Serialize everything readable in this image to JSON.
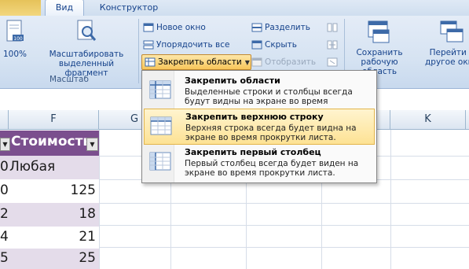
{
  "tabs": {
    "view": "Вид",
    "design": "Конструктор"
  },
  "ribbon": {
    "zoom100_label": "100%",
    "zoom_selection_label": "Масштабировать выделенный фрагмент",
    "zoom_group_label": "Масштаб",
    "new_window": "Новое окно",
    "arrange_all": "Упорядочить все",
    "freeze_panes": "Закрепить области",
    "split": "Разделить",
    "hide": "Скрыть",
    "unhide": "Отобразить",
    "save_workspace": "Сохранить рабочую область",
    "switch_windows": "Перейти в другое окно"
  },
  "columns": {
    "f": "F",
    "g": "G",
    "k": "K"
  },
  "table": {
    "header": "Стоимость",
    "rows": [
      {
        "row_stub": "0",
        "value": "Любая"
      },
      {
        "row_stub": "0",
        "value": "125"
      },
      {
        "row_stub": "2",
        "value": "18"
      },
      {
        "row_stub": "4",
        "value": "21"
      },
      {
        "row_stub": "5",
        "value": "25"
      }
    ]
  },
  "menu": {
    "items": [
      {
        "title": "Закрепить области",
        "desc": "Выделенные строки и столбцы всегда будут видны на экране во время прокрутки листа."
      },
      {
        "title": "Закрепить верхнюю строку",
        "desc": "Верхняя строка всегда будет видна на экране во время прокрутки листа."
      },
      {
        "title": "Закрепить первый столбец",
        "desc": "Первый столбец всегда будет виден на экране во время прокрутки листа."
      }
    ]
  },
  "colors": {
    "accent": "#f8c65a",
    "table_header": "#7b4f8e",
    "band": "#e4dcea"
  }
}
